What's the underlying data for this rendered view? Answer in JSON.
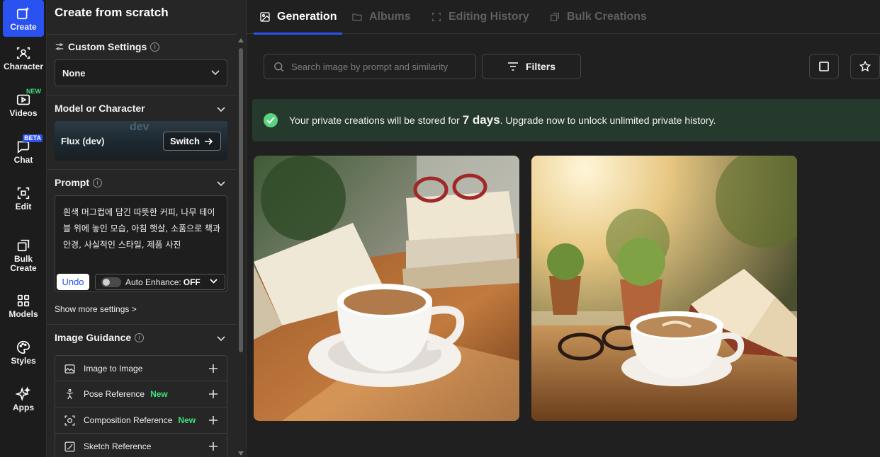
{
  "rail": {
    "items": [
      {
        "label": "Create",
        "icon": "sparkle-edit-icon",
        "active": true
      },
      {
        "label": "Character",
        "icon": "character-icon"
      },
      {
        "label": "Videos",
        "icon": "video-icon",
        "badge": "NEW"
      },
      {
        "label": "Chat",
        "icon": "chat-icon",
        "badge": "BETA"
      },
      {
        "label": "Edit",
        "icon": "edit-icon"
      },
      {
        "label": "Bulk Create",
        "icon": "bulk-icon"
      },
      {
        "label": "Models",
        "icon": "grid-icon"
      },
      {
        "label": "Styles",
        "icon": "palette-icon"
      },
      {
        "label": "Apps",
        "icon": "apps-sparkle-icon"
      }
    ]
  },
  "panel": {
    "title": "Create from scratch",
    "custom_settings": {
      "heading": "Custom Settings",
      "value": "None"
    },
    "model": {
      "heading": "Model or Character",
      "name": "Flux (dev)",
      "bg_word": "dev",
      "switch_label": "Switch"
    },
    "prompt": {
      "heading": "Prompt",
      "text": "흰색 머그컵에 담긴 따뜻한 커피, 나무 테이블 위에 놓인 모습, 아침 햇살, 소품으로 책과 안경, 사실적인 스타일, 제품 사진",
      "undo_label": "Undo",
      "enhance_label": "Auto Enhance:",
      "enhance_state": "OFF"
    },
    "show_more": "Show more settings >",
    "guidance": {
      "heading": "Image Guidance",
      "items": [
        {
          "label": "Image to Image",
          "new": ""
        },
        {
          "label": "Pose Reference",
          "new": "New"
        },
        {
          "label": "Composition Reference",
          "new": "New"
        },
        {
          "label": "Sketch Reference",
          "new": ""
        }
      ]
    }
  },
  "main": {
    "tabs": [
      {
        "label": "Generation",
        "active": true
      },
      {
        "label": "Albums"
      },
      {
        "label": "Editing History"
      },
      {
        "label": "Bulk Creations"
      }
    ],
    "search_placeholder": "Search image by prompt and similarity",
    "filters_label": "Filters",
    "notice": {
      "pre": "Your private creations will be stored for",
      "days": "7 days",
      "post": ". Upgrade now to unlock unlimited private history."
    }
  },
  "colors": {
    "accent": "#2a52f0",
    "success": "#5ad37e",
    "new_badge": "#3ee07a",
    "notice_bg": "#253a2c"
  }
}
